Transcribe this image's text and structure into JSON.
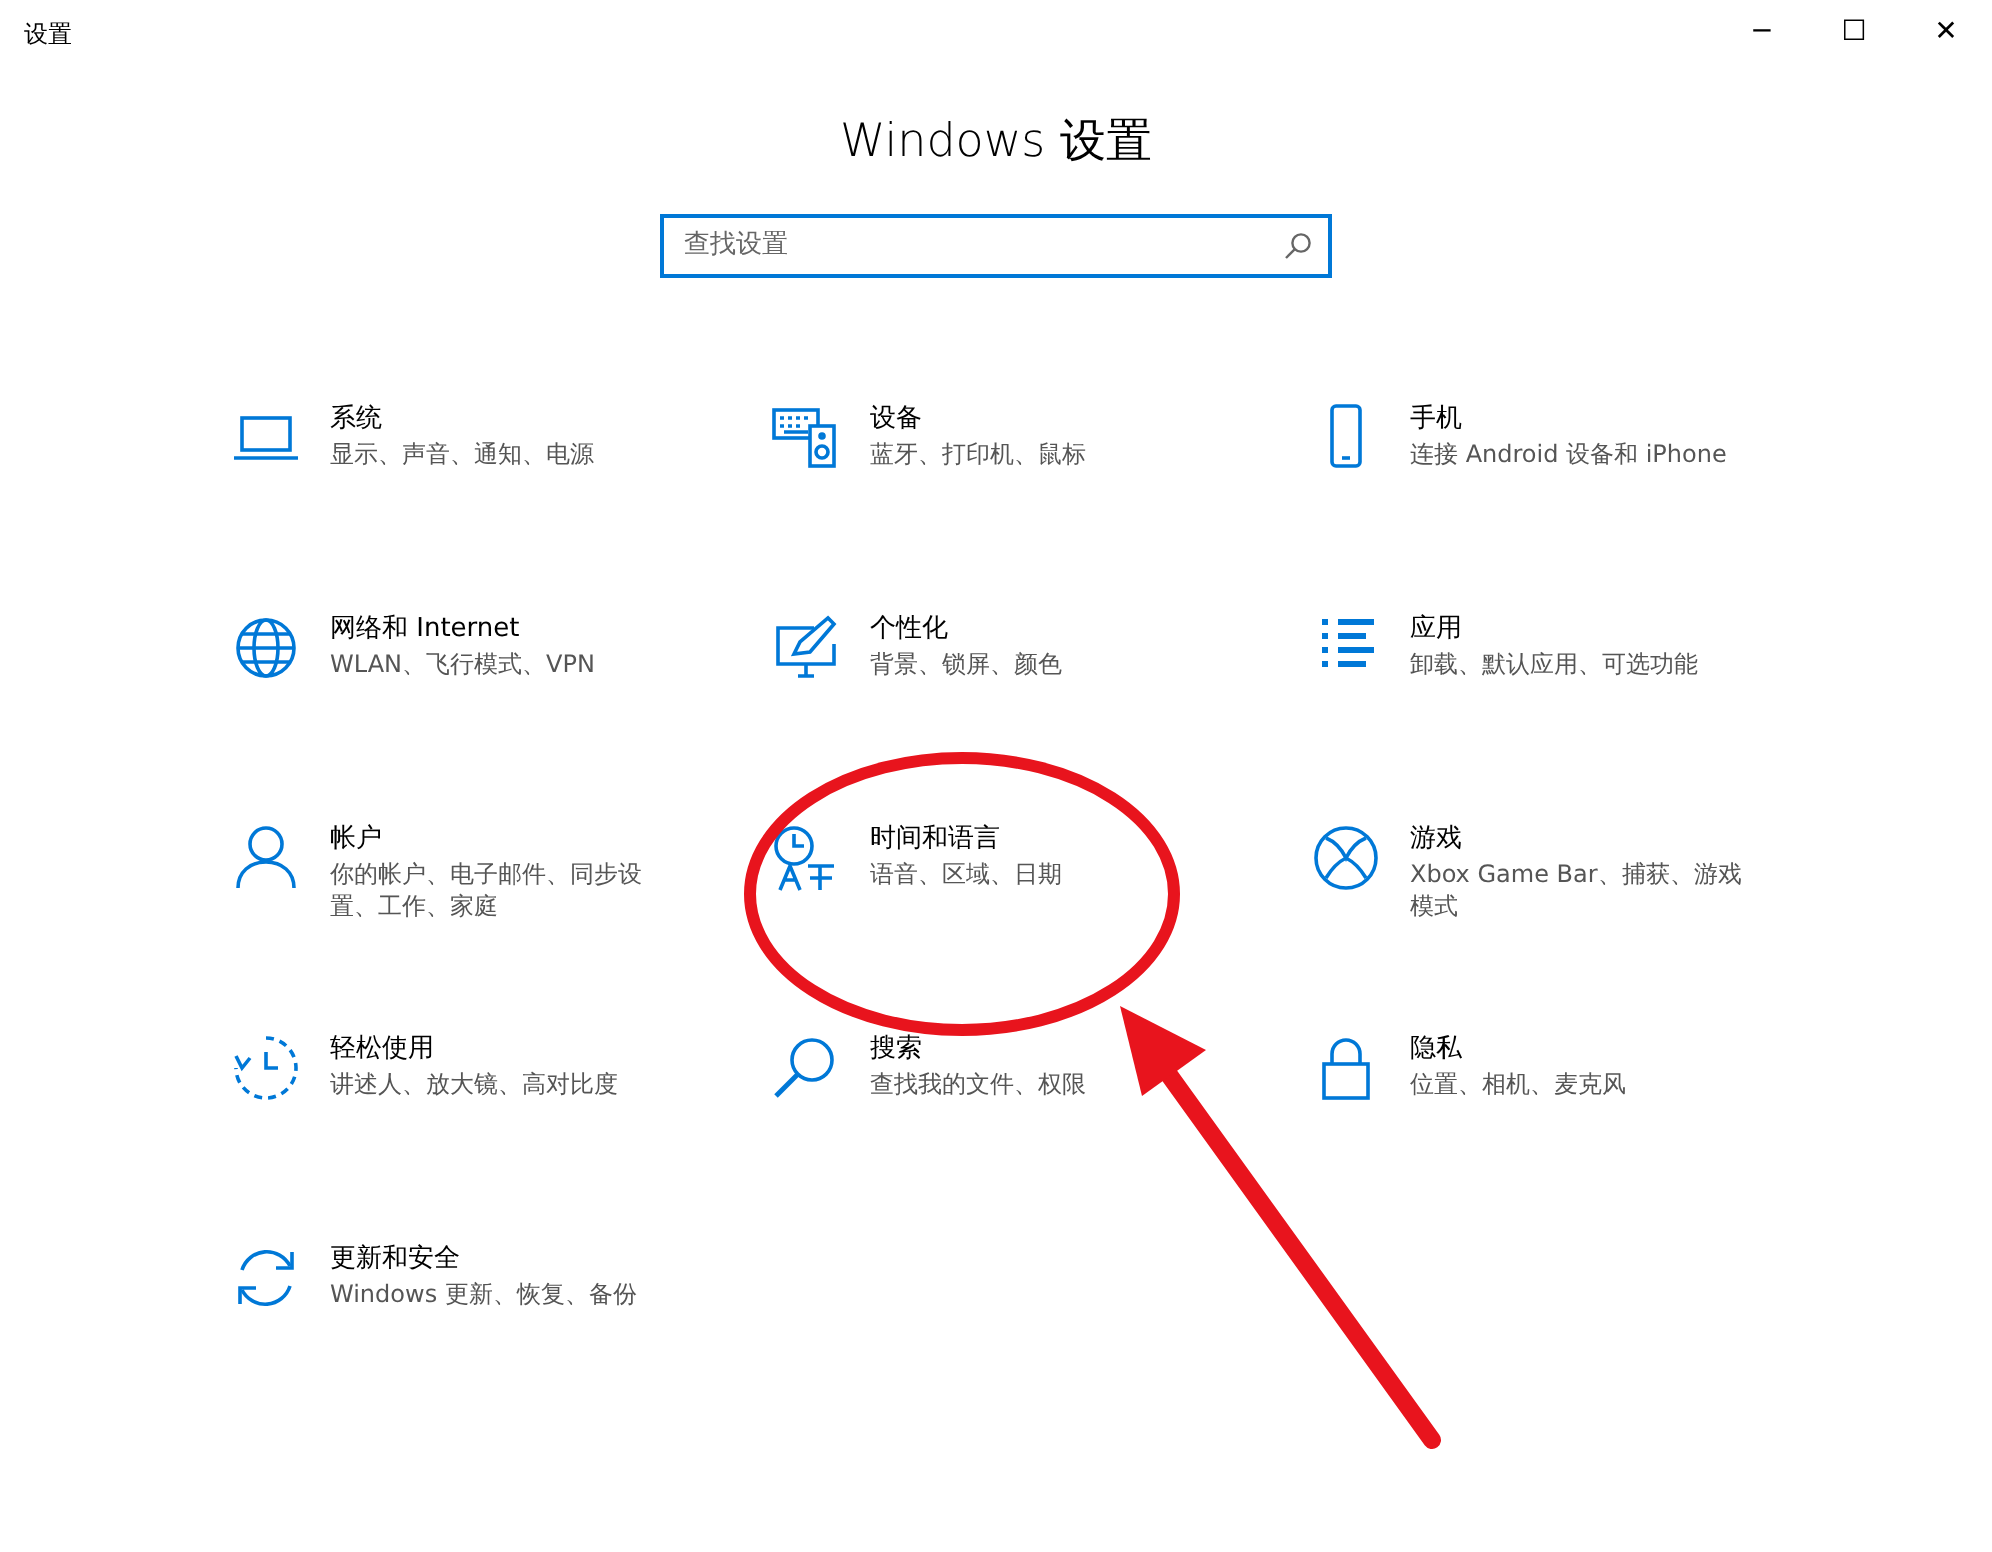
{
  "window": {
    "title": "设置",
    "controls": [
      "─",
      "☐",
      "✕"
    ]
  },
  "heading": "Windows 设置",
  "search": {
    "placeholder": "查找设置"
  },
  "categories": [
    {
      "title": "系统",
      "description": "显示、声音、通知、电源"
    },
    {
      "title": "设备",
      "description": "蓝牙、打印机、鼠标"
    },
    {
      "title": "手机",
      "description": "连接 Android 设备和 iPhone"
    },
    {
      "title": "网络和 Internet",
      "description": "WLAN、飞行模式、VPN"
    },
    {
      "title": "个性化",
      "description": "背景、锁屏、颜色"
    },
    {
      "title": "应用",
      "description": "卸载、默认应用、可选功能"
    },
    {
      "title": "帐户",
      "description": "你的帐户、电子邮件、同步设置、工作、家庭"
    },
    {
      "title": "时间和语言",
      "description": "语音、区域、日期"
    },
    {
      "title": "游戏",
      "description": "Xbox Game Bar、捕获、游戏模式"
    },
    {
      "title": "轻松使用",
      "description": "讲述人、放大镜、高对比度"
    },
    {
      "title": "搜索",
      "description": "查找我的文件、权限"
    },
    {
      "title": "隐私",
      "description": "位置、相机、麦克风"
    },
    {
      "title": "更新和安全",
      "description": "Windows 更新、恢复、备份"
    }
  ]
}
